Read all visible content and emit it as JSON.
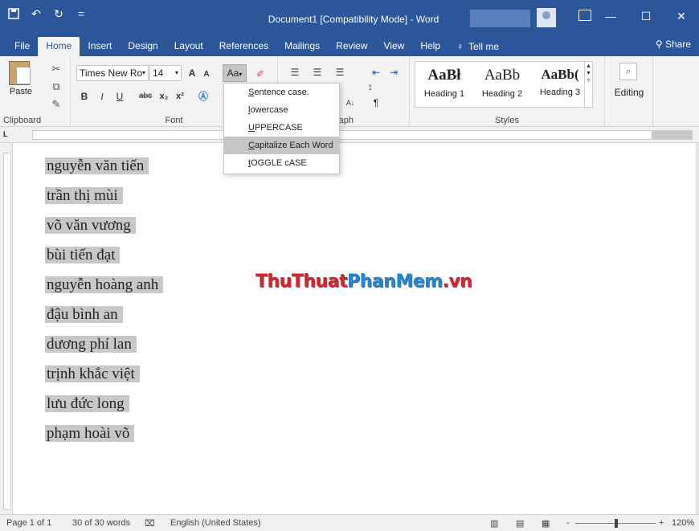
{
  "titlebar": {
    "title": "Document1 [Compatibility Mode]  -  Word",
    "save_icon": "save-icon",
    "undo_icon": "undo-icon",
    "redo_icon": "redo-icon",
    "more": "=",
    "min": "—",
    "max": "☐",
    "close": "✕"
  },
  "tabs": [
    "File",
    "Home",
    "Insert",
    "Design",
    "Layout",
    "References",
    "Mailings",
    "Review",
    "View",
    "Help"
  ],
  "tell_me": "Tell me",
  "share": "Share",
  "ribbon": {
    "clipboard": {
      "paste": "Paste",
      "label": "Clipboard"
    },
    "font": {
      "name": "Times New Ro",
      "size": "14",
      "grow": "A",
      "shrink": "A",
      "case_btn": "Aa",
      "bold": "B",
      "italic": "I",
      "underline": "U",
      "strike": "abc",
      "sub": "x₂",
      "sup": "x²",
      "label": "Font"
    },
    "paragraph": {
      "label": "Paragraph",
      "visible_label": "raph"
    },
    "styles": {
      "items": [
        {
          "preview": "AaBł",
          "name": "Heading 1"
        },
        {
          "preview": "AaBb",
          "name": "Heading 2"
        },
        {
          "preview": "AaBb(",
          "name": "Heading 3"
        }
      ],
      "label": "Styles"
    },
    "editing": {
      "label": "Editing"
    }
  },
  "case_menu": [
    {
      "pre": "",
      "u": "S",
      "post": "entence case."
    },
    {
      "pre": "",
      "u": "l",
      "post": "owercase"
    },
    {
      "pre": "",
      "u": "U",
      "post": "PPERCASE"
    },
    {
      "pre": "",
      "u": "C",
      "post": "apitalize Each Word"
    },
    {
      "pre": "",
      "u": "t",
      "post": "OGGLE cASE"
    }
  ],
  "document": {
    "lines": [
      "nguyễn văn tiến",
      "trần thị mùi",
      "võ văn vương",
      "bùi tiến đạt",
      "nguyễn hoàng anh",
      "đậu bình an",
      "dương phí lan",
      "trịnh khắc việt",
      "lưu đức long",
      "phạm hoài võ"
    ],
    "watermark": {
      "a": "Thu",
      "b": "Thuat",
      "c": "PhanMem",
      "d": ".vn"
    }
  },
  "statusbar": {
    "page": "Page 1 of 1",
    "words": "30 of 30 words",
    "language": "English (United States)",
    "zoom": "120%",
    "minus": "-",
    "plus": "+"
  },
  "colors": {
    "accent": "#2b579a",
    "selection": "#c8c8c8"
  }
}
